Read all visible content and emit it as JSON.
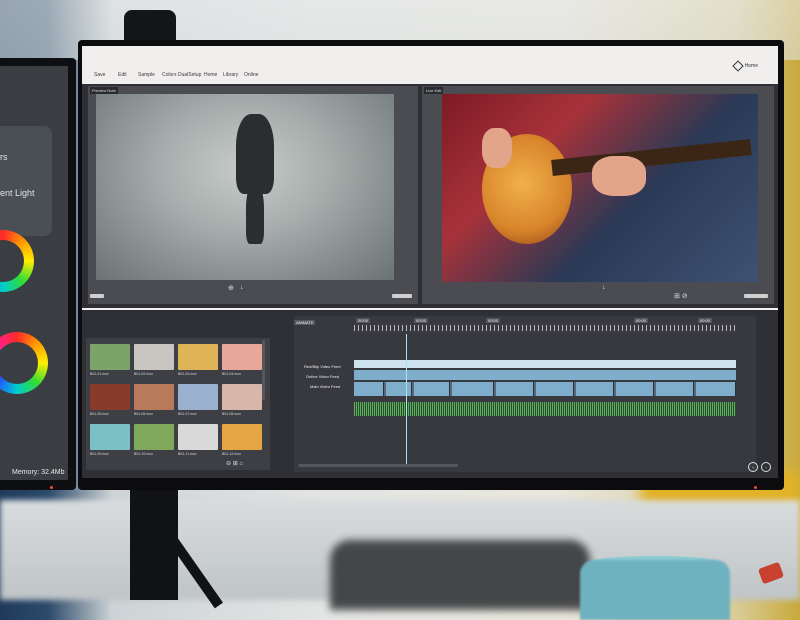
{
  "main_window": {
    "menu": [
      "Save",
      "Edit",
      "Sample",
      "Colors",
      "DualSetup",
      "Home",
      "Library",
      "Online"
    ],
    "home_label": "Home",
    "source_viewer_label": "Preview Note",
    "program_viewer_label": "Live Edit",
    "timeline_tag": "ANIMATE",
    "tracks": [
      "Red/Blip Video Feed",
      "Online Video Feed",
      "Main Video Feed"
    ],
    "timeline_tags": [
      "00:00",
      "00:00",
      "00:00",
      "00:00",
      "00:00"
    ]
  },
  "media_bin": {
    "clips": [
      {
        "name": "B01-01.mov",
        "color": "#7ba36a"
      },
      {
        "name": "B01-02.mov",
        "color": "#c9c6c1"
      },
      {
        "name": "B01-03.mov",
        "color": "#dfb457"
      },
      {
        "name": "B01-04.mov",
        "color": "#e9a799"
      },
      {
        "name": "B01-05.mov",
        "color": "#8a3a2a"
      },
      {
        "name": "B01-06.mov",
        "color": "#b87a5a"
      },
      {
        "name": "B01-07.mov",
        "color": "#9ab0cf"
      },
      {
        "name": "B01-08.mov",
        "color": "#d8b6a9"
      },
      {
        "name": "B01-09.mov",
        "color": "#7bc0c4"
      },
      {
        "name": "B01-10.mov",
        "color": "#7fa85b"
      },
      {
        "name": "B01-11.mov",
        "color": "#d9d9d9"
      },
      {
        "name": "B01-12.mov",
        "color": "#e6a444"
      }
    ]
  },
  "left_monitor": {
    "partial_label_1": "rs",
    "partial_label_2": "ent Light",
    "memory": "Memory: 32.4Mb"
  },
  "colors": {
    "accent_clip": "#7eaecb",
    "waveform": "#5bb05b",
    "playhead": "#a6e2f4"
  }
}
